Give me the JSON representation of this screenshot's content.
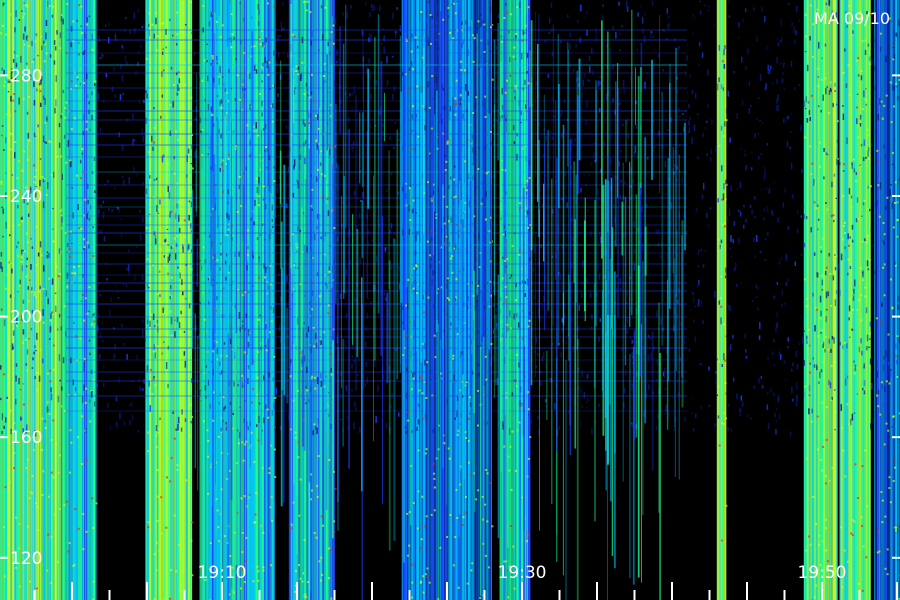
{
  "chart_data": {
    "type": "heatmap",
    "title": "MA 09/10",
    "xlabel": "",
    "ylabel": "",
    "x_ticks": [
      "19:10",
      "19:30",
      "19:50"
    ],
    "x_tick_minutes": [
      10,
      30,
      50
    ],
    "x_range_minutes": [
      -4.8,
      55.2
    ],
    "y_ticks": [
      120,
      160,
      200,
      240,
      280
    ],
    "ylim": [
      106,
      305
    ],
    "grid": false,
    "colormap": [
      "#000000",
      "#0a1a80",
      "#1e3cff",
      "#00c8ff",
      "#20ff90",
      "#c8ff20",
      "#ff2000"
    ],
    "bright_bands_minutes": [
      {
        "from": -4.8,
        "to": -0.7,
        "level": "high"
      },
      {
        "from": -0.6,
        "to": 1.6,
        "level": "medium"
      },
      {
        "from": 4.9,
        "to": 8.0,
        "level": "high"
      },
      {
        "from": 8.5,
        "to": 13.5,
        "level": "medium"
      },
      {
        "from": 14.5,
        "to": 17.5,
        "level": "medium"
      },
      {
        "from": 22.0,
        "to": 28.0,
        "level": "low"
      },
      {
        "from": 28.5,
        "to": 30.5,
        "level": "medium"
      },
      {
        "from": 43.0,
        "to": 43.6,
        "level": "high"
      },
      {
        "from": 48.8,
        "to": 51.0,
        "level": "high"
      },
      {
        "from": 51.2,
        "to": 53.2,
        "level": "high"
      },
      {
        "from": 53.5,
        "to": 55.2,
        "level": "low"
      }
    ],
    "dark_bands_minutes": [
      {
        "from": 2.0,
        "to": 4.3
      },
      {
        "from": 41.5,
        "to": 42.2
      },
      {
        "from": 44.0,
        "to": 46.0
      }
    ]
  }
}
